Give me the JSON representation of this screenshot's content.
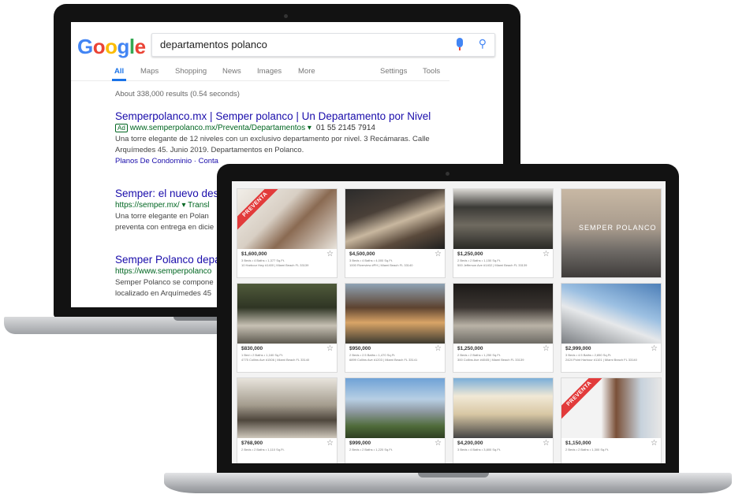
{
  "google": {
    "logo_letters": [
      {
        "ch": "G",
        "color": "#4285f4"
      },
      {
        "ch": "o",
        "color": "#ea4335"
      },
      {
        "ch": "o",
        "color": "#fbbc05"
      },
      {
        "ch": "g",
        "color": "#4285f4"
      },
      {
        "ch": "l",
        "color": "#34a853"
      },
      {
        "ch": "e",
        "color": "#ea4335"
      }
    ],
    "query": "departamentos polanco",
    "tabs": {
      "all": "All",
      "maps": "Maps",
      "shopping": "Shopping",
      "news": "News",
      "images": "Images",
      "more": "More",
      "settings": "Settings",
      "tools": "Tools"
    },
    "stats": "About 338,000 results (0.54 seconds)",
    "results": [
      {
        "title": "Semperpolanco.mx | Semper polanco | Un Departamento por Nivel",
        "ad_label": "Ad",
        "url": "www.semperpolanco.mx/Preventa/Departamentos ▾",
        "phone": "01 55 2145 7914",
        "snippet": "Una torre elegante de 12 niveles con un exclusivo departamento por nivel. 3 Recámaras. Calle Arquímedes 45. Junio 2019. Departamentos en Polanco.",
        "links": "Planos De Condominio · Conta"
      },
      {
        "title": "Semper: el nuevo des",
        "url": "https://semper.mx/ ▾ Transl",
        "snippet": "Una torre elegante en Polan preventa con entrega en dicie"
      },
      {
        "title": "Semper Polanco depa",
        "url": "https://www.semperpolanco",
        "snippet": "Semper Polanco se compone localizado en Arquímedes 45"
      }
    ]
  },
  "listings": [
    {
      "price": "$1,600,000",
      "beds": "3 Beds  •  4 Baths  •  1,377 Sq.Ft.",
      "addr": "10 Harbour Hwy #1400 | Miami Beach FL 33139",
      "ribbon": "PREVENTA",
      "overlay": ""
    },
    {
      "price": "$4,500,000",
      "beds": "3 Beds  •  4 Baths  •  4,000 Sq.Ft.",
      "addr": "1000 Riverview #PH | Miami Beach FL 33140",
      "ribbon": "",
      "overlay": ""
    },
    {
      "price": "$1,250,000",
      "beds": "2 Beds  •  2 Baths  •  1,150 Sq.Ft.",
      "addr": "500 Jefferson Ave #1402 | Miami Beach FL 33139",
      "ribbon": "",
      "overlay": ""
    },
    {
      "price": "",
      "beds": "",
      "addr": "",
      "ribbon": "",
      "overlay": "SEMPER POLANCO"
    },
    {
      "price": "$830,000",
      "beds": "1 Bed  •  2 Baths  •  1,160 Sq.Ft.",
      "addr": "4775 Collins Ave #1506 | Miami Beach FL 33140",
      "ribbon": "",
      "overlay": ""
    },
    {
      "price": "$950,000",
      "beds": "2 Beds  •  2.5 Baths  •  1,470 Sq.Ft.",
      "addr": "6899 Collins Ave #1203 | Miami Beach FL 33141",
      "ribbon": "",
      "overlay": ""
    },
    {
      "price": "$1,250,000",
      "beds": "2 Beds  •  2 Baths  •  1,250 Sq.Ft.",
      "addr": "300 Collins Ave #404B | Miami Beach FL 33139",
      "ribbon": "",
      "overlay": ""
    },
    {
      "price": "$2,999,000",
      "beds": "3 Beds  •  4.5 Baths  •  2,850 Sq.Ft.",
      "addr": "2424 Point Harbour #1101 | Miami Beach FL 33140",
      "ribbon": "",
      "overlay": ""
    },
    {
      "price": "$768,900",
      "beds": "2 Beds  •  2 Baths  •  1,110 Sq.Ft.",
      "addr": "",
      "ribbon": "",
      "overlay": ""
    },
    {
      "price": "$999,000",
      "beds": "2 Beds  •  2 Baths  •  1,220 Sq.Ft.",
      "addr": "",
      "ribbon": "",
      "overlay": ""
    },
    {
      "price": "$4,200,000",
      "beds": "3 Beds  •  4 Baths  •  3,800 Sq.Ft.",
      "addr": "",
      "ribbon": "",
      "overlay": ""
    },
    {
      "price": "$1,150,000",
      "beds": "2 Beds  •  2 Baths  •  1,300 Sq.Ft.",
      "addr": "",
      "ribbon": "PREVENTA",
      "overlay": ""
    }
  ]
}
